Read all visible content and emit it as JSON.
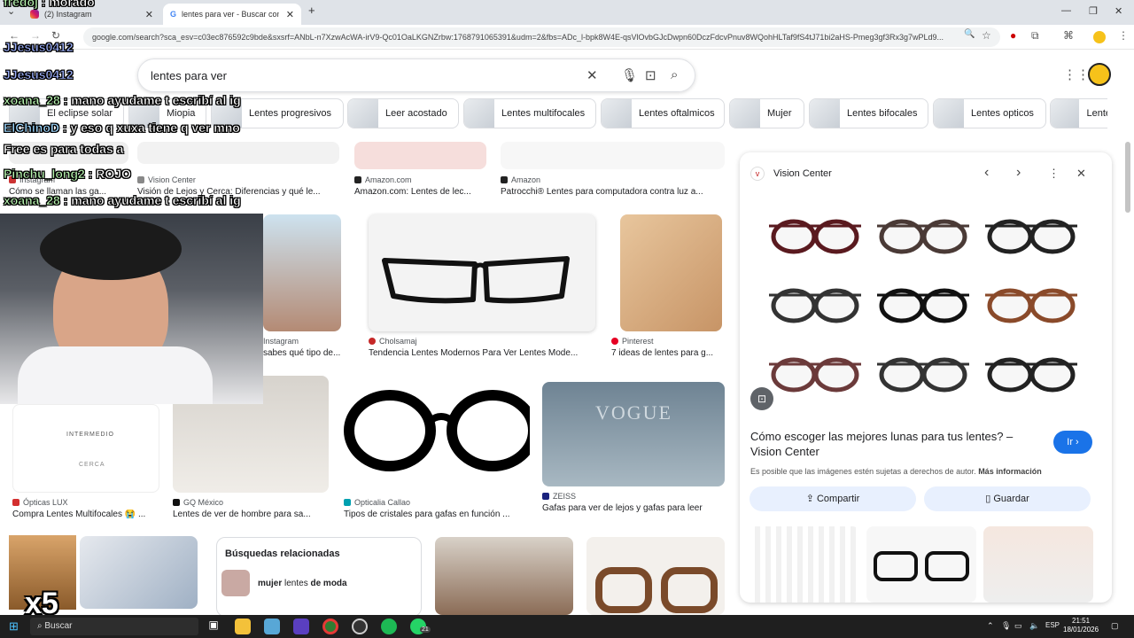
{
  "browser": {
    "tabs": [
      {
        "label": "(2) Instagram"
      },
      {
        "label": "lentes para ver - Buscar con Go"
      }
    ],
    "url": "google.com/search?sca_esv=c03ec876592c9bde&sxsrf=ANbL-n7XzwAcWA-irV9-Qc01OaLKGNZrbw:1768791065391&udm=2&fbs=ADc_l-bpk8W4E-qsVlOvbGJcDwpn60DczFdcvPnuv8WQohHLTaf9fS4tJ71bi2aHS-Pmeg3gf3Rx3g7wPLd9..."
  },
  "search": {
    "query": "lentes para ver"
  },
  "chips": [
    "El eclipse solar",
    "Miopia",
    "Lentes progresivos",
    "Leer acostado",
    "Lentes multifocales",
    "Lentes oftalmicos",
    "Mujer",
    "Lentes bifocales",
    "Lentes opticos",
    "Lente"
  ],
  "results_row1": [
    {
      "source": "Instagram",
      "title": "Cómo se llaman las ga..."
    },
    {
      "source": "Vision Center",
      "title": "Visión de Lejos y Cerca: Diferencias y qué le..."
    },
    {
      "source": "Amazon.com",
      "title": "Amazon.com: Lentes de lec..."
    },
    {
      "source": "Amazon",
      "title": "Patrocchi® Lentes para computadora contra luz a..."
    }
  ],
  "results_row2": [
    {
      "source": "Instagram",
      "title": "sabes qué tipo de..."
    },
    {
      "source": "Cholsamaj",
      "title": "Tendencia Lentes Modernos Para Ver Lentes Mode..."
    },
    {
      "source": "Pinterest",
      "title": "7 ideas de lentes para g..."
    }
  ],
  "results_row3": [
    {
      "source": "Ópticas LUX",
      "title": "Compra Lentes Multifocales 😭 ...",
      "img_text_1": "INTERMEDIO",
      "img_text_2": "CERCA"
    },
    {
      "source": "GQ México",
      "title": "Lentes de ver de hombre para sa..."
    },
    {
      "source": "Opticalia Callao",
      "title": "Tipos de cristales para gafas en función ..."
    },
    {
      "source": "ZEISS",
      "title": "Gafas para ver de lejos y gafas para leer",
      "img_text": "VOGUE"
    }
  ],
  "related": {
    "heading": "Búsquedas relacionadas",
    "item": {
      "pre": "mujer",
      "mid": " lentes ",
      "post": "de moda"
    }
  },
  "panel": {
    "site": "Vision Center",
    "title": "Cómo escoger las mejores lunas para tus lentes? – Vision Center",
    "go": "Ir",
    "rights": "Es posible que las imágenes estén sujetas a derechos de autor.",
    "more_info": "Más información",
    "share": "Compartir",
    "save": "Guardar"
  },
  "overlay_chat": [
    {
      "user": "fredoj",
      "msg": " : morado"
    },
    {
      "user": "JJesus0412",
      "msg": ""
    },
    {
      "user": "JJesus0412",
      "msg": ""
    },
    {
      "user": "xoana_28",
      "msg": " : mano ayudame t escribí al ig"
    },
    {
      "user": "ElChinoD",
      "msg": " : y eso q xuxa tiene q ver mno"
    },
    {
      "user": "",
      "msg": "Free es para todas a"
    },
    {
      "user": "Pinchu_long2",
      "msg": " : ROJO"
    },
    {
      "user": "xoana_28",
      "msg": " : mano ayudame t escribí al ig"
    }
  ],
  "overlay_multiplier": "x5",
  "taskbar": {
    "search": "Buscar",
    "lang": "ESP",
    "time": "21:51",
    "date": "18/01/2026",
    "badge": "21"
  },
  "colors": {
    "accent": "#1a73e8",
    "chip_border": "#dadce0",
    "taskbar": "#1f1f1f"
  }
}
